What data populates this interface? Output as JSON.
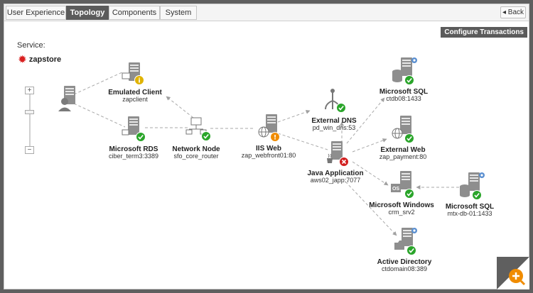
{
  "tabs": [
    {
      "label": "User Experience",
      "active": false
    },
    {
      "label": "Topology",
      "active": true
    },
    {
      "label": "Components",
      "active": false
    },
    {
      "label": "System",
      "active": false
    }
  ],
  "back_label": "Back",
  "configure_label": "Configure Transactions",
  "service": {
    "label": "Service:",
    "name": "zapstore"
  },
  "colors": {
    "ok": "#2aa52a",
    "warn": "#e0b300",
    "alert": "#f08c00",
    "error": "#d22020",
    "accent": "#f08c00"
  },
  "nodes": {
    "emulated_client": {
      "name": "Emulated Client",
      "host": "zapclient",
      "status": "info"
    },
    "ms_rds": {
      "name": "Microsoft RDS",
      "host": "ciber_term3:3389",
      "status": "ok"
    },
    "network_node": {
      "name": "Network Node",
      "host": "sfo_core_router",
      "status": "ok"
    },
    "iis_web": {
      "name": "IIS Web",
      "host": "zap_webfront01:80",
      "status": "warning"
    },
    "external_dns": {
      "name": "External DNS",
      "host": "pd_win_dns:53",
      "status": "ok"
    },
    "ms_sql_1": {
      "name": "Microsoft SQL",
      "host": "ctdb08:1433",
      "status": "ok"
    },
    "external_web": {
      "name": "External Web",
      "host": "zap_payment:80",
      "status": "ok"
    },
    "java_app": {
      "name": "Java Application",
      "host": "aws02_japp:7077",
      "status": "error"
    },
    "ms_windows": {
      "name": "Microsoft Windows",
      "host": "crm_srv2",
      "status": "ok"
    },
    "ms_sql_2": {
      "name": "Microsoft SQL",
      "host": "mtx-db-01:1433",
      "status": "ok"
    },
    "active_directory": {
      "name": "Active Directory",
      "host": "ctdomain08:389",
      "status": "ok"
    }
  }
}
